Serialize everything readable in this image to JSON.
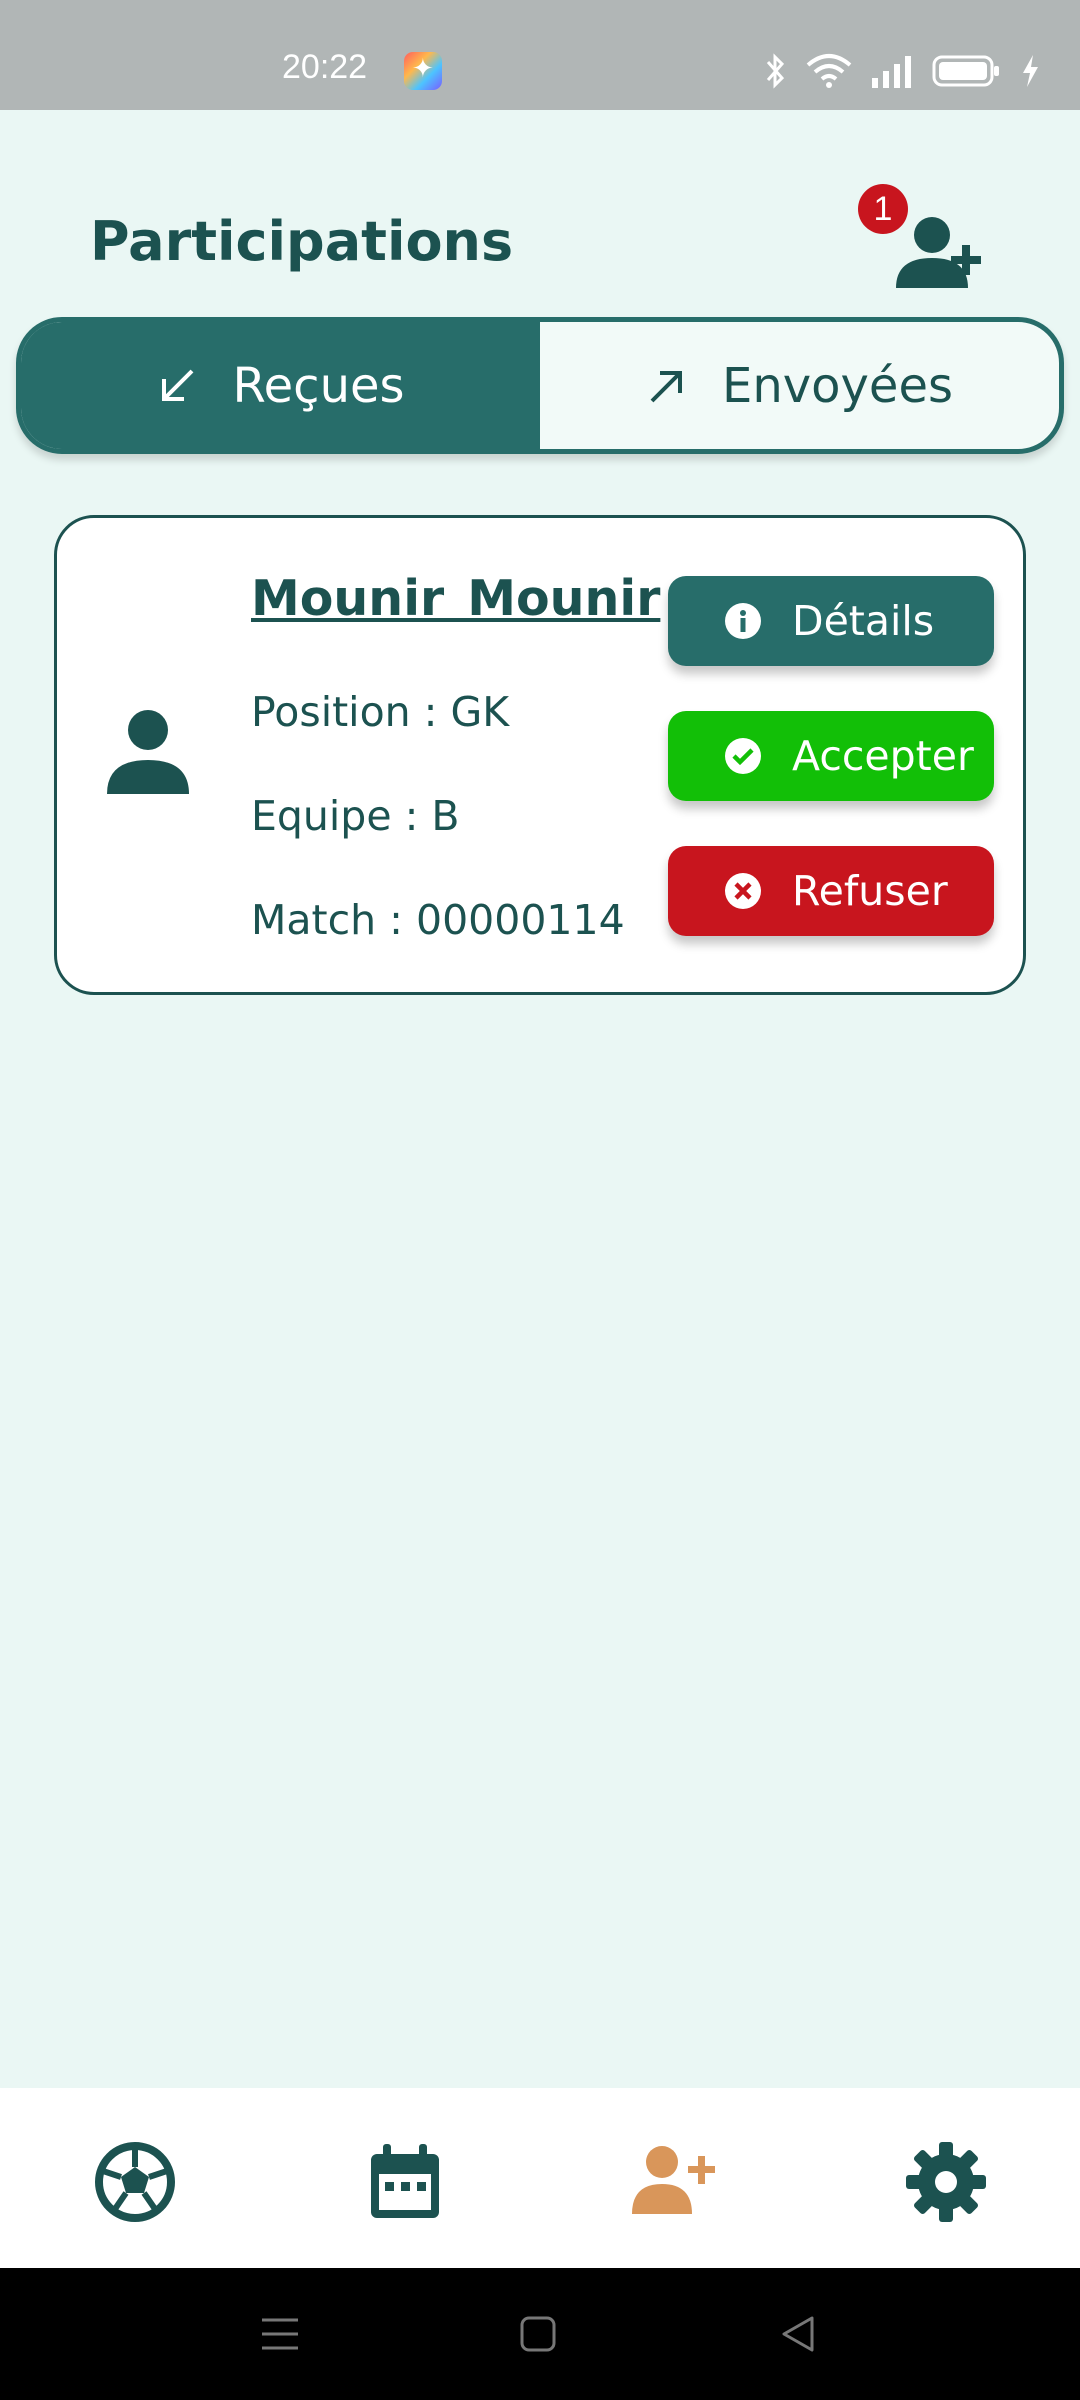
{
  "status_bar": {
    "time": "20:22"
  },
  "header": {
    "title": "Participations",
    "badge_count": "1"
  },
  "tabs": [
    {
      "label": "Reçues",
      "icon": "arrow-down-left-icon",
      "active": true
    },
    {
      "label": "Envoyées",
      "icon": "arrow-up-right-icon",
      "active": false
    }
  ],
  "card": {
    "name": "Mounir Mounir",
    "position": "Position : GK",
    "team": "Equipe : B",
    "match": "Match : 00000114",
    "buttons": {
      "details": "Détails",
      "accept": "Accepter",
      "refuse": "Refuser"
    }
  },
  "bottom_nav": [
    {
      "icon": "soccer-ball-icon",
      "active": false
    },
    {
      "icon": "calendar-icon",
      "active": false
    },
    {
      "icon": "add-user-icon",
      "active": true
    },
    {
      "icon": "gear-icon",
      "active": false
    }
  ],
  "colors": {
    "primary": "#276d6a",
    "accept": "#12bf07",
    "refuse": "#c8151e",
    "nav_active": "#d9965a",
    "background": "#eaf7f4"
  }
}
